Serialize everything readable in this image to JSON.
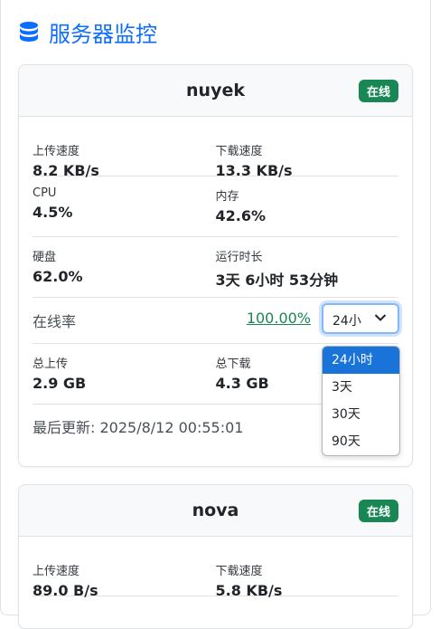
{
  "header": {
    "title": "服务器监控",
    "icon": "database-icon",
    "accent": "#0d6efd"
  },
  "servers": [
    {
      "name": "nuyek",
      "status": "在线",
      "upload_speed_label": "上传速度",
      "upload_speed": "8.2 KB/s",
      "download_speed_label": "下载速度",
      "download_speed": "13.3 KB/s",
      "cpu_label": "CPU",
      "cpu": "4.5%",
      "memory_label": "内存",
      "memory": "42.6%",
      "disk_label": "硬盘",
      "disk": "62.0%",
      "runtime_label": "运行时长",
      "runtime": "3天 6小时 53分钟",
      "uptime_label": "在线率",
      "uptime": "100.00%",
      "period_selected": "24小",
      "total_upload_label": "总上传",
      "total_upload": "2.9 GB",
      "total_download_label": "总下载",
      "total_download": "4.3 GB",
      "last_update": "最后更新: 2025/8/12 00:55:01"
    },
    {
      "name": "nova",
      "status": "在线",
      "upload_speed_label": "上传速度",
      "upload_speed": "89.0 B/s",
      "download_speed_label": "下载速度",
      "download_speed": "5.8 KB/s"
    }
  ],
  "period_options": [
    "24小时",
    "3天",
    "30天",
    "90天"
  ],
  "colors": {
    "online": "#198754",
    "selected_option": "#1a73d9"
  }
}
